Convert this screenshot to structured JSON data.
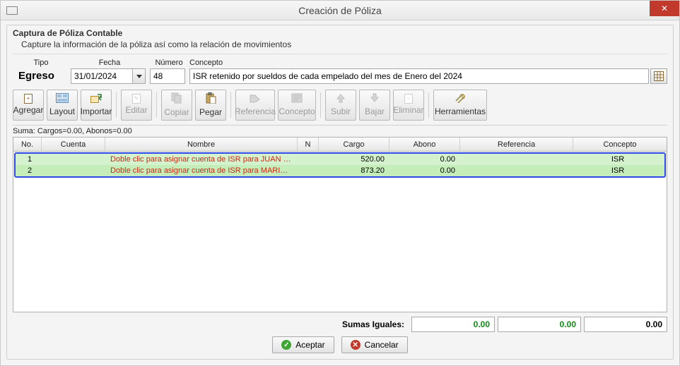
{
  "window": {
    "title": "Creación de Póliza",
    "close_glyph": "✕"
  },
  "section": {
    "title": "Captura de Póliza Contable",
    "desc": "Capture la información de la póliza así como la relación de movimientos"
  },
  "labels": {
    "tipo": "Tipo",
    "fecha": "Fecha",
    "numero": "Número",
    "concepto": "Concepto"
  },
  "form": {
    "tipo_value": "Egreso",
    "fecha_value": "31/01/2024",
    "numero_value": "48",
    "concepto_value": "ISR retenido por sueldos de cada empelado del mes de Enero del 2024"
  },
  "toolbar": {
    "agregar": "Agregar",
    "layout": "Layout",
    "importar": "Importar",
    "editar": "Editar",
    "copiar": "Copiar",
    "pegar": "Pegar",
    "referencia": "Referencia",
    "concepto": "Concepto",
    "subir": "Subir",
    "bajar": "Bajar",
    "eliminar": "Eliminar",
    "herramientas": "Herramientas"
  },
  "summary_line": "Suma:  Cargos=0.00, Abonos=0.00",
  "grid": {
    "headers": {
      "no": "No.",
      "cuenta": "Cuenta",
      "nombre": "Nombre",
      "n": "N",
      "cargo": "Cargo",
      "abono": "Abono",
      "referencia": "Referencia",
      "concepto": "Concepto"
    },
    "rows": [
      {
        "no": "1",
        "cuenta": "",
        "nombre": "Doble clic para asignar cuenta de ISR para JUAN PEREZ LOPEZ",
        "n": "",
        "cargo": "520.00",
        "abono": "0.00",
        "referencia": "",
        "concepto": "ISR"
      },
      {
        "no": "2",
        "cuenta": "",
        "nombre": "Doble clic para asignar cuenta de ISR para MARIO INOCENCIO CASTRO VIDALES",
        "n": "",
        "cargo": "873.20",
        "abono": "0.00",
        "referencia": "",
        "concepto": "ISR"
      }
    ]
  },
  "footer": {
    "label": "Sumas Iguales:",
    "cargo_sum": "0.00",
    "abono_sum": "0.00",
    "diff": "0.00"
  },
  "actions": {
    "accept": "Aceptar",
    "cancel": "Cancelar"
  }
}
